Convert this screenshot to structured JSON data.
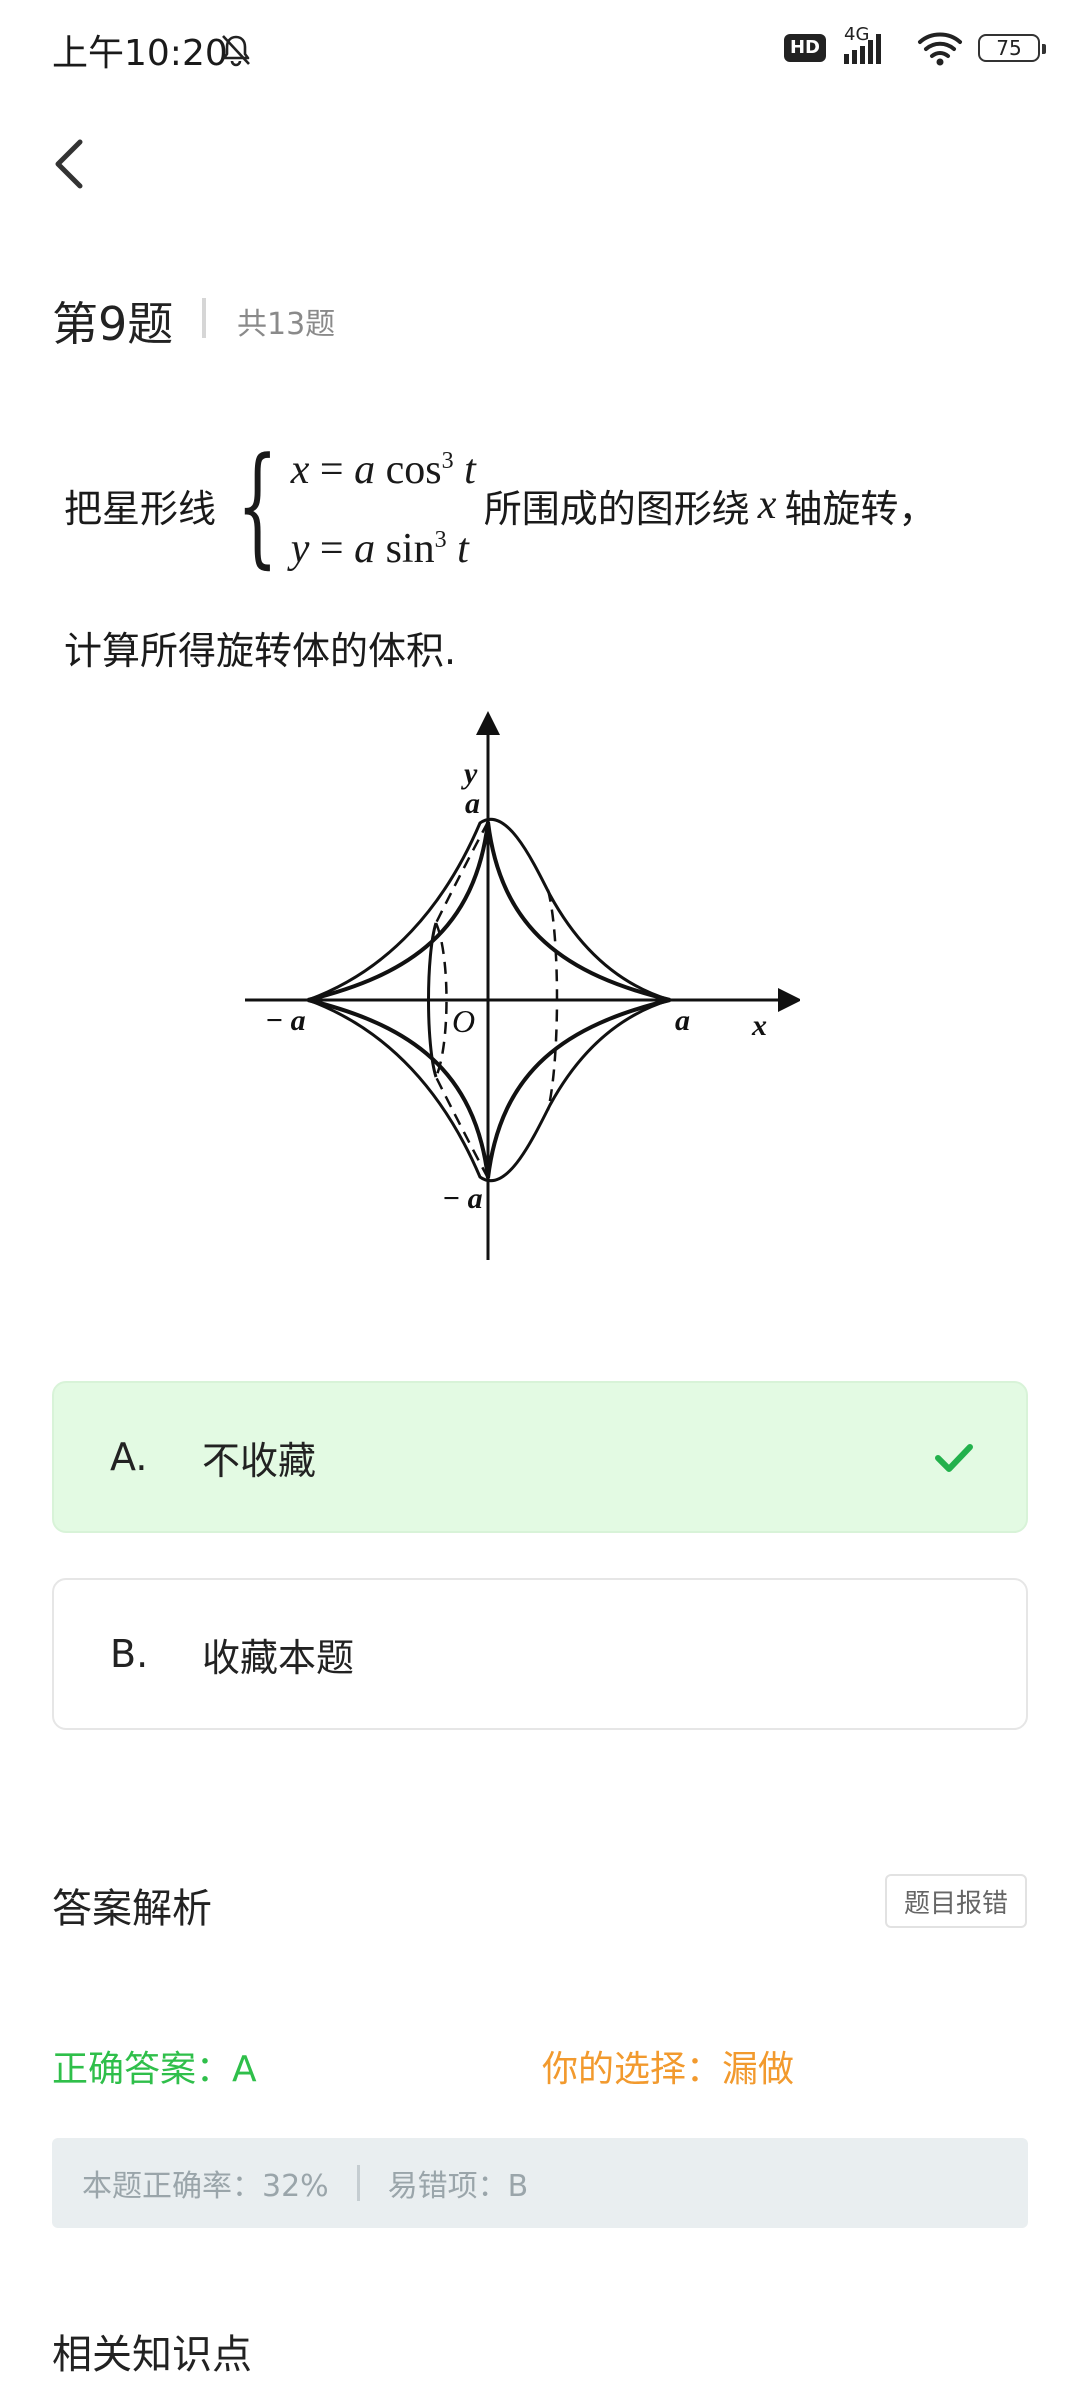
{
  "status": {
    "time": "上午10:20",
    "hd": "HD",
    "network": "4G",
    "battery": "75"
  },
  "header": {
    "question_label": "第9题",
    "total_label": "共13题"
  },
  "question": {
    "prefix": "把星形线",
    "eq1_lhs": "x",
    "eq1_rhs_var": "a",
    "eq1_func": "cos",
    "eq1_exp": "3",
    "eq1_arg": "t",
    "eq2_lhs": "y",
    "eq2_rhs_var": "a",
    "eq2_func": "sin",
    "eq2_exp": "3",
    "eq2_arg": "t",
    "mid": "所围成的图形绕",
    "axis_var": "x",
    "suffix": "轴旋转，",
    "line2": "计算所得旋转体的体积."
  },
  "figure": {
    "y_axis": "y",
    "x_axis": "x",
    "origin": "O",
    "top_label": "a",
    "bottom_label": "− a",
    "left_label": "− a",
    "right_label": "a"
  },
  "options": [
    {
      "letter": "A.",
      "text": "不收藏",
      "selected": true
    },
    {
      "letter": "B.",
      "text": "收藏本题",
      "selected": false
    }
  ],
  "analysis": {
    "title": "答案解析",
    "report_button": "题目报错",
    "correct_answer": "正确答案：A",
    "your_choice": "你的选择：漏做",
    "accuracy": "本题正确率：32%",
    "common_error": "易错项：B",
    "knowledge_title": "相关知识点"
  },
  "colors": {
    "correct": "#2fbf4a",
    "your_choice": "#f29a2e",
    "selected_bg": "#e3fae3"
  }
}
